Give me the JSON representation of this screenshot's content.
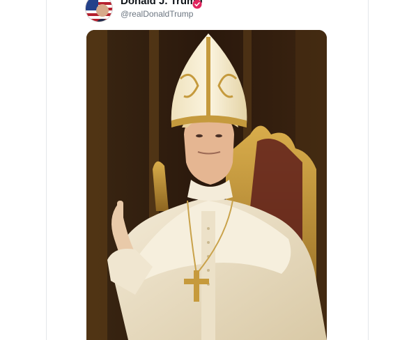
{
  "post": {
    "author_name": "Donald J. Trump",
    "author_handle": "@realDonaldTrump",
    "verified": true,
    "badge_color": "#e0245e"
  },
  "media": {
    "type": "image",
    "subject_icon": "pope-portrait-image"
  },
  "colors": {
    "background": "#ffffff",
    "divider": "#e3e6ea",
    "name_text": "#0f1419",
    "handle_text": "#6b7580"
  }
}
